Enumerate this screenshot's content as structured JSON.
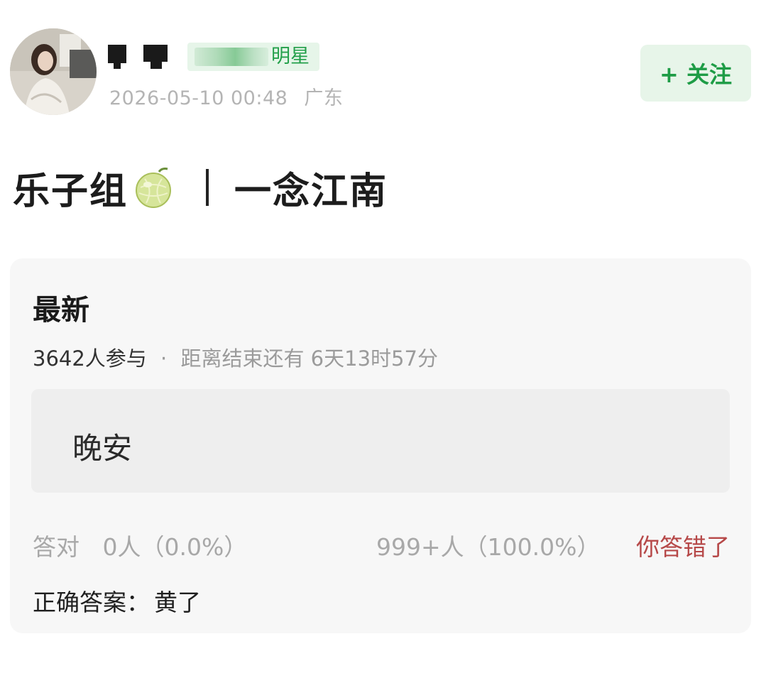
{
  "post": {
    "badge_text": "明星",
    "date": "2026-05-10 00:48",
    "location": "广东",
    "follow_label": "+ 关注"
  },
  "title": {
    "left": "乐子组",
    "right": "一念江南"
  },
  "quiz": {
    "heading": "最新",
    "participants": "3642人参与",
    "separator": "·",
    "remaining": "距离结束还有 6天13时57分",
    "option": "晚安",
    "correct_label": "答对",
    "correct_stats": "0人（0.0%）",
    "chosen_stats": "999+人（100.0%）",
    "result": "你答错了",
    "answer_label": "正确答案：",
    "answer_value": "黄了"
  },
  "colors": {
    "accent_green": "#1e9c46",
    "follow_bg": "#e7f5e9",
    "wrong_red": "#b64848",
    "card_bg": "#f7f7f7"
  }
}
